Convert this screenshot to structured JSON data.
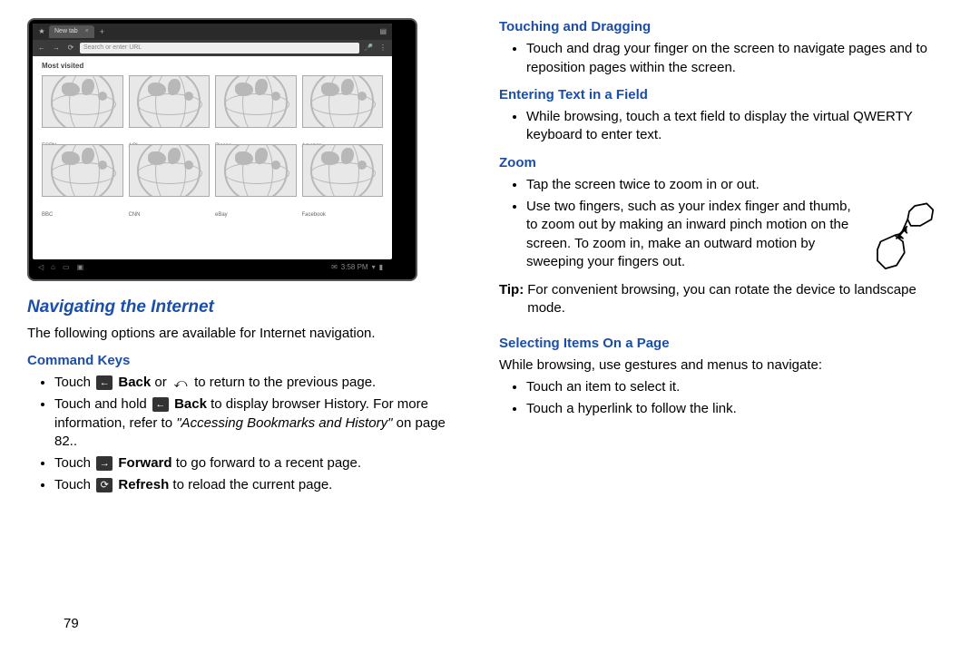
{
  "tablet": {
    "tab_label": "New tab",
    "url_placeholder": "Search or enter URL",
    "most_visited": "Most visited",
    "thumbs": [
      "ESPN",
      "AOL",
      "Picasa",
      "Amazon",
      "BBC",
      "CNN",
      "eBay",
      "Facebook"
    ],
    "clock": "3:58 PM"
  },
  "left": {
    "h1": "Navigating the Internet",
    "intro": "The following options are available for Internet navigation.",
    "h2": "Command Keys",
    "b1_a": "Touch ",
    "b1_b": " Back",
    "b1_c": " or ",
    "b1_d": " to return to the previous page.",
    "b2_a": "Touch and hold ",
    "b2_b": " Back",
    "b2_c": " to display browser History. For more information, refer to ",
    "b2_ref": "\"Accessing Bookmarks and History\"",
    "b2_d": " on page 82..",
    "b3_a": "Touch ",
    "b3_b": " Forward",
    "b3_c": " to go forward to a recent page.",
    "b4_a": "Touch ",
    "b4_b": " Refresh",
    "b4_c": " to reload the current page."
  },
  "right": {
    "h1": "Touching and Dragging",
    "b1": "Touch and drag your finger on the screen to navigate pages and to reposition pages within the screen.",
    "h2": "Entering Text in a Field",
    "b2": "While browsing, touch a text field to display the virtual QWERTY keyboard to enter text.",
    "h3": "Zoom",
    "z1": "Tap the screen twice to zoom in or out.",
    "z2": "Use two fingers, such as your index finger and thumb, to zoom out by making an inward pinch motion on the screen. To zoom in, make an outward motion by sweeping your fingers out.",
    "tip_label": "Tip:",
    "tip": "For convenient browsing, you can rotate the device to landscape mode.",
    "h4": "Selecting Items On a Page",
    "sel_intro": "While browsing, use gestures and menus to navigate:",
    "s1": "Touch an item to select it.",
    "s2": "Touch a hyperlink to follow the link."
  },
  "page_number": "79"
}
